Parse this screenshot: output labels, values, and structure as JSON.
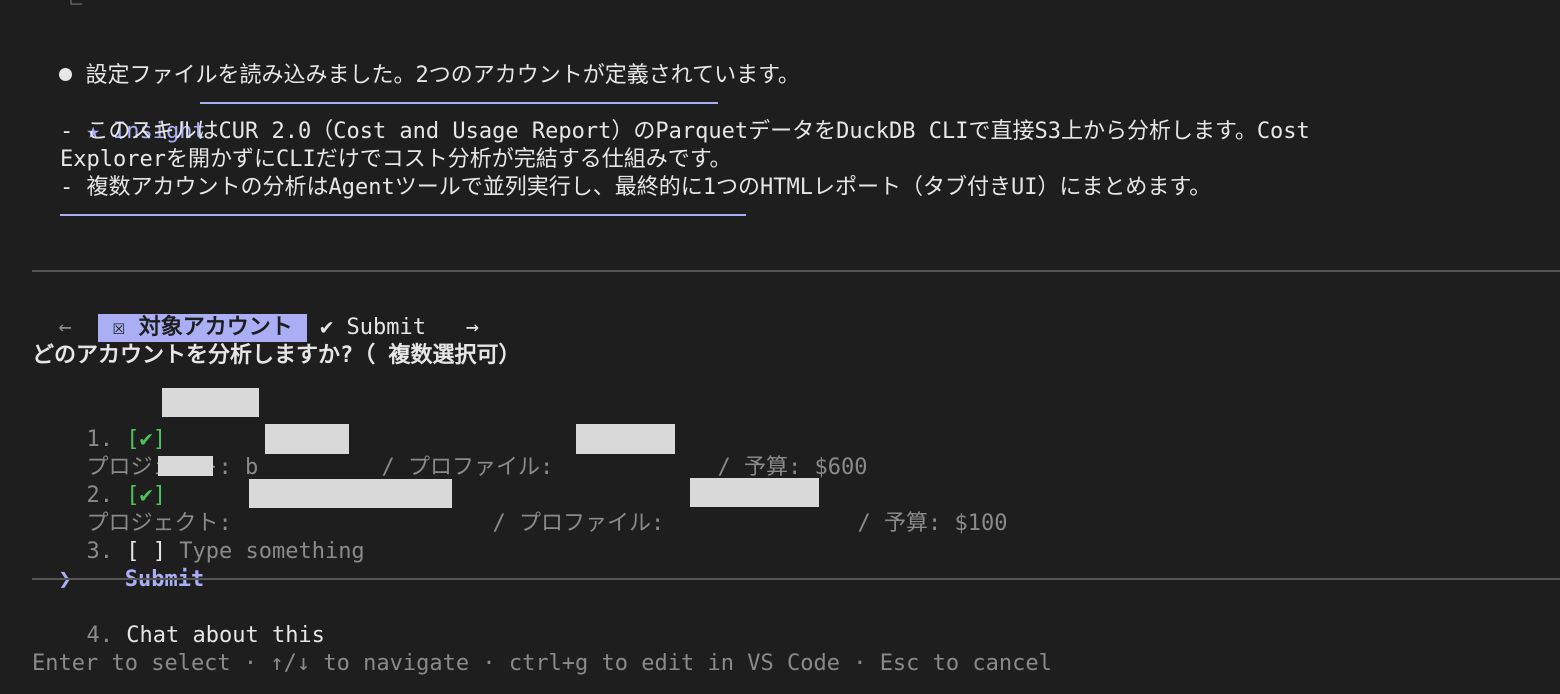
{
  "message": {
    "text": "設定ファイルを読み込みました。2つのアカウントが定義されています。"
  },
  "insight": {
    "star": "★",
    "title": "Insight",
    "line1": "- このスキルはCUR 2.0（Cost and Usage Report）のParquetデータをDuckDB CLIで直接S3上から分析します。Cost",
    "line2": "Explorerを開かずにCLIだけでコスト分析が完結する仕組みです。",
    "line3": "- 複数アカウントの分析はAgentツールで並列実行し、最終的に1つのHTMLレポート（タブ付きUI）にまとめます。"
  },
  "tabs": {
    "left_arrow": "←",
    "active_icon": "☒",
    "active_label": "対象アカウント",
    "submit_check": "✔",
    "submit_label": "Submit",
    "right_arrow": "→"
  },
  "question": "どのアカウントを分析しますか?（ 複数選択可）",
  "options": [
    {
      "num": "1.",
      "check": "[✔]",
      "project_label": "プロジェクト: ",
      "project_prefix": "b",
      "profile_label": "/ プロファイル: ",
      "budget_label": "/ 予算: ",
      "budget_value": "$600"
    },
    {
      "num": "2.",
      "check": "[✔]",
      "project_label": "プロジェクト: ",
      "profile_label": "/ プロファイル: ",
      "budget_label": "/ 予算: ",
      "budget_value": "$100"
    },
    {
      "num": "3.",
      "check": "[ ]",
      "placeholder": "Type something"
    }
  ],
  "submit": {
    "cursor": "❯",
    "label": "Submit"
  },
  "chat": {
    "num": "4.",
    "label": "Chat about this"
  },
  "footer": {
    "hint": "Enter to select · ↑/↓ to navigate · ctrl+g to edit in VS Code · Esc to cancel"
  },
  "colors": {
    "background": "#1e1e1e",
    "accent": "#a9aef5",
    "check_green": "#4ec25a",
    "dim_text": "#8a8a8a"
  }
}
